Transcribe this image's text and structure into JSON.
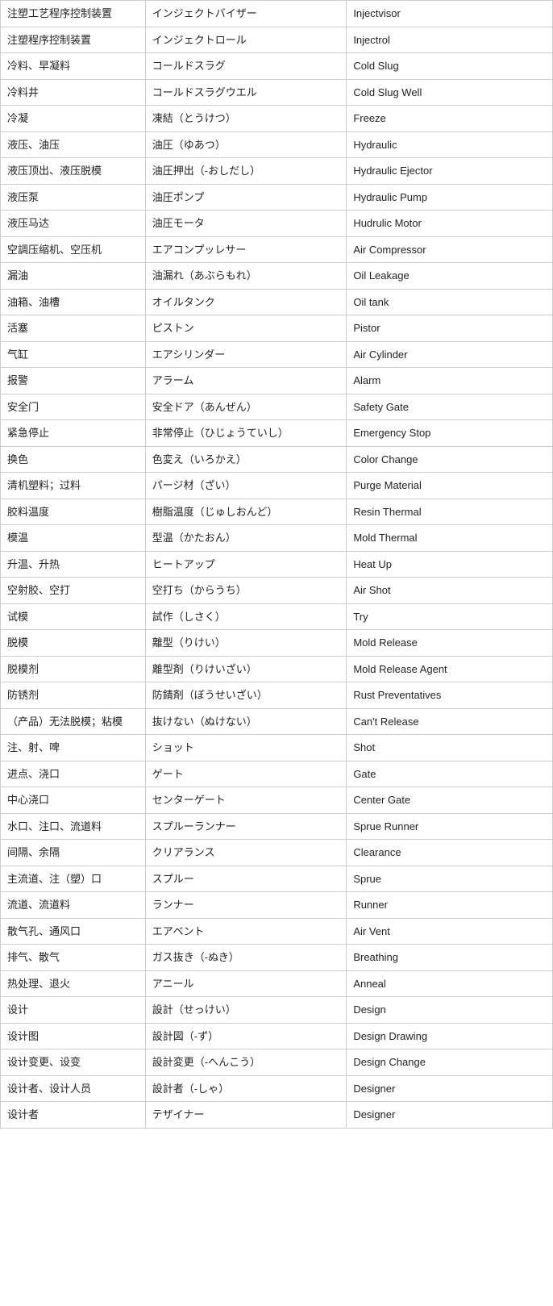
{
  "rows": [
    {
      "chinese": "注塑工艺程序控制装置",
      "japanese": "インジェクトバイザー",
      "english": "Injectvisor"
    },
    {
      "chinese": "注塑程序控制装置",
      "japanese": "インジェクトロール",
      "english": "Injectrol"
    },
    {
      "chinese": "冷料、早凝料",
      "japanese": "コールドスラグ",
      "english": "Cold Slug"
    },
    {
      "chinese": "冷料井",
      "japanese": "コールドスラグウエル",
      "english": "Cold Slug  Well"
    },
    {
      "chinese": "冷凝",
      "japanese": "凍結（とうけつ）",
      "english": "Freeze"
    },
    {
      "chinese": "液压、油压",
      "japanese": "油圧（ゆあつ）",
      "english": "Hydraulic"
    },
    {
      "chinese": "液压顶出、液压脱模",
      "japanese": "油圧押出（-おしだし）",
      "english": "Hydraulic  Ejector"
    },
    {
      "chinese": "液压泵",
      "japanese": "油圧ポンプ",
      "english": "Hydraulic  Pump"
    },
    {
      "chinese": "液压马达",
      "japanese": "油圧モータ",
      "english": "Hudrulic  Motor"
    },
    {
      "chinese": "空調压缩机、空压机",
      "japanese": "エアコンプッレサー",
      "english": "Air  Compressor"
    },
    {
      "chinese": "漏油",
      "japanese": "油漏れ（あぶらもれ）",
      "english": "Oil  Leakage"
    },
    {
      "chinese": "油箱、油槽",
      "japanese": "オイルタンク",
      "english": "Oil tank"
    },
    {
      "chinese": "活塞",
      "japanese": "ピストン",
      "english": "Pistor"
    },
    {
      "chinese": "气缸",
      "japanese": "エアシリンダー",
      "english": "Air  Cylinder"
    },
    {
      "chinese": "报警",
      "japanese": "アラーム",
      "english": "Alarm"
    },
    {
      "chinese": "安全门",
      "japanese": "安全ドア（あんぜん）",
      "english": "Safety  Gate"
    },
    {
      "chinese": "紧急停止",
      "japanese": "非常停止（ひじょうていし）",
      "english": "Emergency  Stop"
    },
    {
      "chinese": "换色",
      "japanese": "色変え（いろかえ）",
      "english": "Color  Change"
    },
    {
      "chinese": "清机塑料；过料",
      "japanese": "パージ材（ざい）",
      "english": "Purge  Material"
    },
    {
      "chinese": "胶料温度",
      "japanese": "樹脂温度（じゅしおんど）",
      "english": "Resin  Thermal"
    },
    {
      "chinese": "模温",
      "japanese": "型温（かたおん）",
      "english": "Mold  Thermal"
    },
    {
      "chinese": "升温、升热",
      "japanese": "ヒートアップ",
      "english": "Heat Up"
    },
    {
      "chinese": "空射胶、空打",
      "japanese": "空打ち（からうち）",
      "english": "Air Shot"
    },
    {
      "chinese": "试模",
      "japanese": "試作（しさく）",
      "english": "Try"
    },
    {
      "chinese": "脱模",
      "japanese": "離型（りけい）",
      "english": "Mold  Release"
    },
    {
      "chinese": "脱模剂",
      "japanese": "離型剤（りけいざい）",
      "english": "Mold  Release Agent"
    },
    {
      "chinese": "防锈剂",
      "japanese": "防錆剤（ぼうせいざい）",
      "english": "Rust  Preventatives"
    },
    {
      "chinese": "（产品）无法脱模；粘模",
      "japanese": "抜けない（ぬけない）",
      "english": "Can't  Release"
    },
    {
      "chinese": "注、射、啤",
      "japanese": "ショット",
      "english": "Shot"
    },
    {
      "chinese": "进点、浇口",
      "japanese": "ゲート",
      "english": "Gate"
    },
    {
      "chinese": "中心浇口",
      "japanese": "センターゲート",
      "english": "Center  Gate"
    },
    {
      "chinese": "水口、注口、流道料",
      "japanese": "スプルーランナー",
      "english": "Sprue  Runner"
    },
    {
      "chinese": "间隔、余隔",
      "japanese": "クリアランス",
      "english": "Clearance"
    },
    {
      "chinese": "主流道、注（塑）口",
      "japanese": "スプルー",
      "english": "Sprue"
    },
    {
      "chinese": "流道、流道料",
      "japanese": "ランナー",
      "english": "Runner"
    },
    {
      "chinese": "散气孔、通风口",
      "japanese": "エアベント",
      "english": "Air Vent"
    },
    {
      "chinese": "排气、散气",
      "japanese": "ガス抜き（-ぬき）",
      "english": "Breathing"
    },
    {
      "chinese": "热处理、退火",
      "japanese": "アニール",
      "english": "Anneal"
    },
    {
      "chinese": "设计",
      "japanese": "設計（せっけい）",
      "english": "Design"
    },
    {
      "chinese": "设计图",
      "japanese": "設計図（-ず）",
      "english": "Design  Drawing"
    },
    {
      "chinese": "设计变更、设变",
      "japanese": "設計変更（-へんこう）",
      "english": "Design  Change"
    },
    {
      "chinese": "设计者、设计人员",
      "japanese": "設計者（-しゃ）",
      "english": "Designer"
    },
    {
      "chinese": "设计者",
      "japanese": "テザイナー",
      "english": "Designer"
    }
  ]
}
